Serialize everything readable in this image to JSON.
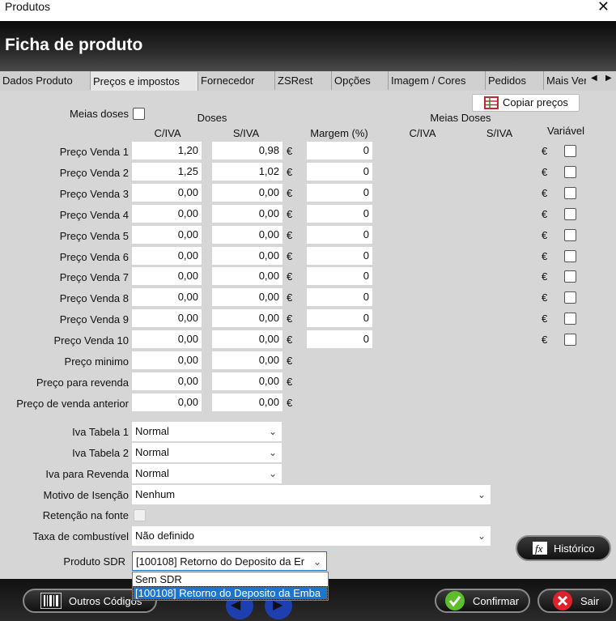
{
  "window": {
    "title": "Produtos",
    "close": "✕"
  },
  "header": {
    "title": "Ficha de produto"
  },
  "tabs": [
    "Dados Produto",
    "Preços e impostos",
    "Fornecedor",
    "ZSRest",
    "Opções",
    "Imagem / Cores",
    "Pedidos",
    "Mais Ver"
  ],
  "tab_arrows": {
    "left": "◀",
    "right": "▶"
  },
  "copy_prices_label": "Copiar preços",
  "meias_doses_label": "Meias doses",
  "headers": {
    "doses": "Doses",
    "civa": "C/IVA",
    "siva": "S/IVA",
    "margem": "Margem (%)",
    "meias_doses": "Meias Doses",
    "md_civa": "C/IVA",
    "md_siva": "S/IVA",
    "variavel": "Variável"
  },
  "currency": "€",
  "price_rows": [
    {
      "label": "Preço Venda 1",
      "civa": "1,20",
      "siva": "0,98",
      "margem": "0"
    },
    {
      "label": "Preço Venda 2",
      "civa": "1,25",
      "siva": "1,02",
      "margem": "0"
    },
    {
      "label": "Preço Venda 3",
      "civa": "0,00",
      "siva": "0,00",
      "margem": "0"
    },
    {
      "label": "Preço Venda 4",
      "civa": "0,00",
      "siva": "0,00",
      "margem": "0"
    },
    {
      "label": "Preço Venda 5",
      "civa": "0,00",
      "siva": "0,00",
      "margem": "0"
    },
    {
      "label": "Preço Venda 6",
      "civa": "0,00",
      "siva": "0,00",
      "margem": "0"
    },
    {
      "label": "Preço Venda 7",
      "civa": "0,00",
      "siva": "0,00",
      "margem": "0"
    },
    {
      "label": "Preço Venda 8",
      "civa": "0,00",
      "siva": "0,00",
      "margem": "0"
    },
    {
      "label": "Preço Venda 9",
      "civa": "0,00",
      "siva": "0,00",
      "margem": "0"
    },
    {
      "label": "Preço Venda 10",
      "civa": "0,00",
      "siva": "0,00",
      "margem": "0"
    }
  ],
  "extra_rows": [
    {
      "label": "Preço minimo",
      "civa": "0,00",
      "siva": "0,00"
    },
    {
      "label": "Preço para revenda",
      "civa": "0,00",
      "siva": "0,00"
    },
    {
      "label": "Preço de venda anterior",
      "civa": "0,00",
      "siva": "0,00"
    }
  ],
  "selects": {
    "iva1": {
      "label": "Iva Tabela 1",
      "value": "Normal"
    },
    "iva2": {
      "label": "Iva Tabela 2",
      "value": "Normal"
    },
    "ivarev": {
      "label": "Iva para Revenda",
      "value": "Normal"
    },
    "isencao": {
      "label": "Motivo de Isenção",
      "value": "Nenhum"
    },
    "retencao": {
      "label": "Retenção na fonte"
    },
    "combustivel": {
      "label": "Taxa de combustível",
      "value": "Não definido"
    },
    "sdr": {
      "label": "Produto SDR",
      "value": "[100108] Retorno do Deposito da Er"
    }
  },
  "sdr_options": [
    "Sem SDR",
    "[100108] Retorno do Deposito da Emba"
  ],
  "buttons": {
    "historico": "Histórico",
    "outros_codigos": "Outros Códigos",
    "confirmar": "Confirmar",
    "sair": "Sair"
  },
  "colors": {
    "accent_selected": "#1976d2",
    "confirm": "#5cbf2a",
    "exit": "#e0202a"
  }
}
